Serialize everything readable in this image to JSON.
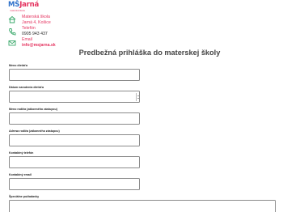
{
  "header": {
    "logo": {
      "ms": "MŠ",
      "jarna": "Jarná",
      "tagline": "materská škola"
    },
    "contacts": {
      "school": {
        "line1": "Materská škola",
        "line2": "Jarná 4, Košice",
        "icon": "home-icon"
      },
      "phone": {
        "line1": "Telefón",
        "line2": "0905 943 437",
        "icon": "phone-icon"
      },
      "email": {
        "line1": "Email",
        "line2": "info@msjarna.sk",
        "icon": "envelope-icon"
      }
    }
  },
  "form": {
    "title": "Predbežná prihláška do materskej školy",
    "fields": {
      "child_name": {
        "label": "Meno dieťaťa",
        "value": ""
      },
      "birth_date": {
        "label": "Dátum narodenia dieťaťa",
        "value": ""
      },
      "parent_name": {
        "label": "Meno rodiča (zákonného zástupcu)",
        "value": ""
      },
      "parent_address": {
        "label": "Adresa rodiča (zákonného zástupcu)",
        "value": ""
      },
      "phone": {
        "label": "Kontaktný telefón",
        "value": ""
      },
      "email": {
        "label": "Kontaktný email",
        "value": ""
      },
      "special_needs": {
        "label": "Špeciálne požiadavky",
        "value": ""
      }
    }
  },
  "colors": {
    "accent_pink": "#e4335f",
    "accent_blue": "#2c6fc9",
    "icon_green": "#3aa86b"
  }
}
